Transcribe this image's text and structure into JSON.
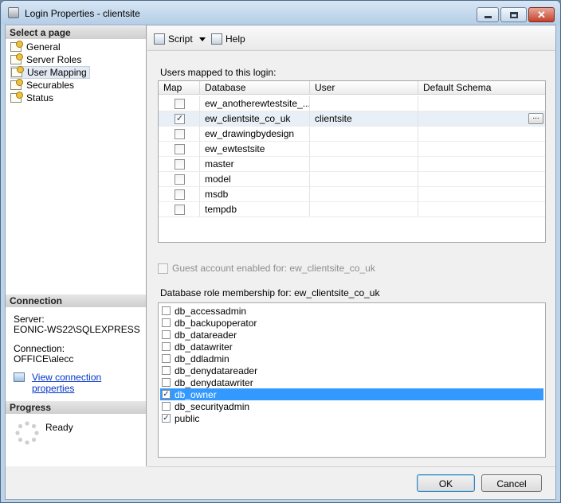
{
  "window": {
    "title": "Login Properties - clientsite",
    "close_glyph": "✕"
  },
  "left": {
    "select_page_header": "Select a page",
    "pages": [
      "General",
      "Server Roles",
      "User Mapping",
      "Securables",
      "Status"
    ],
    "selected_page": "User Mapping",
    "connection_header": "Connection",
    "server_label": "Server:",
    "server_value": "EONIC-WS22\\SQLEXPRESS",
    "connection_label": "Connection:",
    "connection_value": "OFFICE\\alecc",
    "view_link": "View connection properties",
    "progress_header": "Progress",
    "progress_status": "Ready"
  },
  "toolbar": {
    "script_label": "Script",
    "help_label": "Help"
  },
  "users_mapped": {
    "label": "Users mapped to this login:",
    "columns": [
      "Map",
      "Database",
      "User",
      "Default Schema"
    ],
    "rows": [
      {
        "checked": false,
        "database": "ew_anotherewtestsite_...",
        "user": "",
        "schema": ""
      },
      {
        "checked": true,
        "database": "ew_clientsite_co_uk",
        "user": "clientsite",
        "schema": "",
        "ellipsis": "..."
      },
      {
        "checked": false,
        "database": "ew_drawingbydesign",
        "user": "",
        "schema": ""
      },
      {
        "checked": false,
        "database": "ew_ewtestsite",
        "user": "",
        "schema": ""
      },
      {
        "checked": false,
        "database": "master",
        "user": "",
        "schema": ""
      },
      {
        "checked": false,
        "database": "model",
        "user": "",
        "schema": ""
      },
      {
        "checked": false,
        "database": "msdb",
        "user": "",
        "schema": ""
      },
      {
        "checked": false,
        "database": "tempdb",
        "user": "",
        "schema": ""
      }
    ]
  },
  "guest": {
    "label": "Guest account enabled for: ew_clientsite_co_uk",
    "checked": false
  },
  "roles": {
    "label": "Database role membership for: ew_clientsite_co_uk",
    "items": [
      {
        "name": "db_accessadmin",
        "checked": false
      },
      {
        "name": "db_backupoperator",
        "checked": false
      },
      {
        "name": "db_datareader",
        "checked": false
      },
      {
        "name": "db_datawriter",
        "checked": false
      },
      {
        "name": "db_ddladmin",
        "checked": false
      },
      {
        "name": "db_denydatareader",
        "checked": false
      },
      {
        "name": "db_denydatawriter",
        "checked": false
      },
      {
        "name": "db_owner",
        "checked": true,
        "selected": true
      },
      {
        "name": "db_securityadmin",
        "checked": false
      },
      {
        "name": "public",
        "checked": true
      }
    ]
  },
  "buttons": {
    "ok": "OK",
    "cancel": "Cancel"
  },
  "check_glyph": "✓"
}
